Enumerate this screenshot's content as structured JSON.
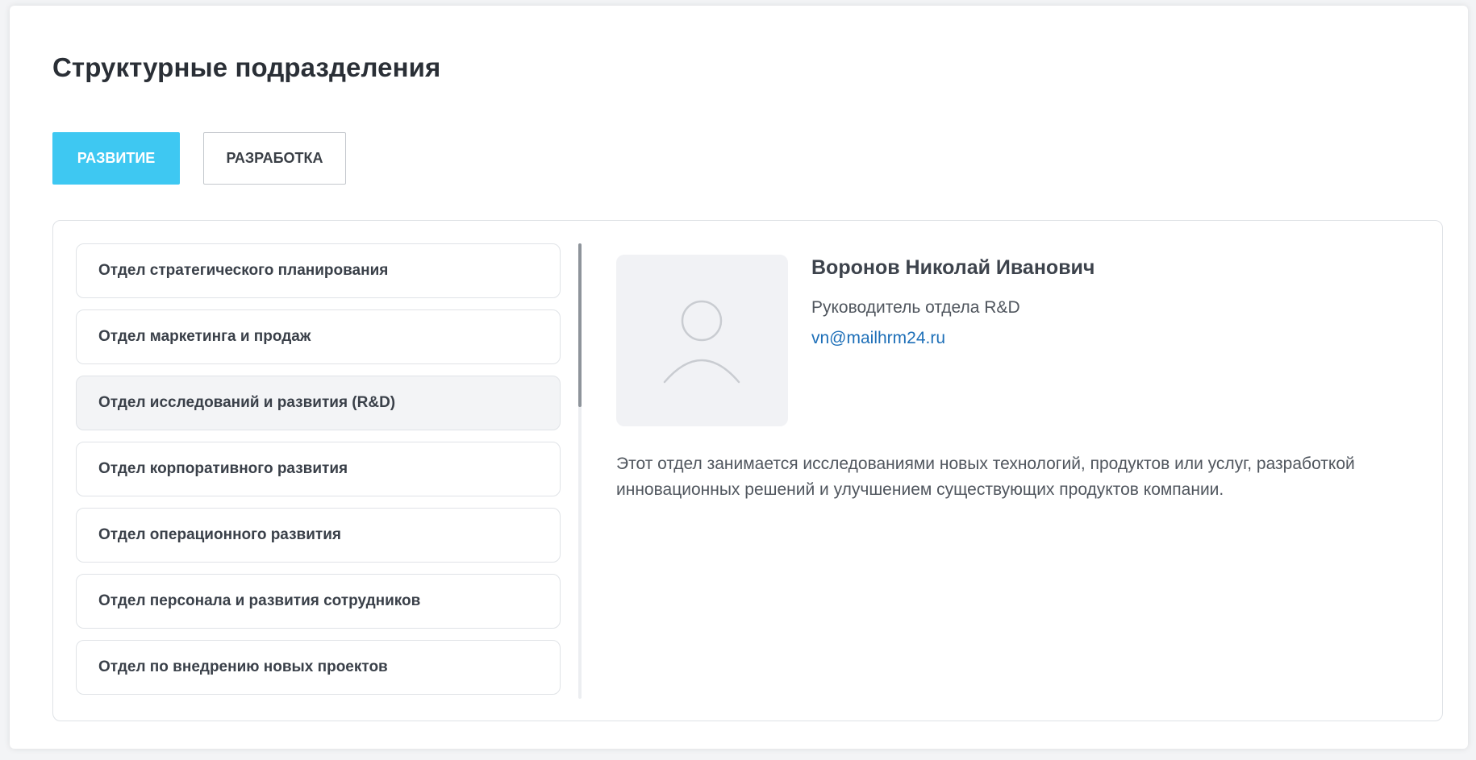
{
  "page": {
    "title": "Структурные подразделения"
  },
  "tabs": [
    {
      "label": "РАЗВИТИЕ",
      "active": true
    },
    {
      "label": "РАЗРАБОТКА",
      "active": false
    }
  ],
  "departments": [
    {
      "label": "Отдел стратегического планирования",
      "selected": false
    },
    {
      "label": "Отдел маркетинга и продаж",
      "selected": false
    },
    {
      "label": "Отдел исследований и развития (R&D)",
      "selected": true
    },
    {
      "label": "Отдел корпоративного развития",
      "selected": false
    },
    {
      "label": "Отдел операционного развития",
      "selected": false
    },
    {
      "label": "Отдел персонала и развития сотрудников",
      "selected": false
    },
    {
      "label": "Отдел по внедрению новых проектов",
      "selected": false
    }
  ],
  "details": {
    "avatar_icon": "user-placeholder-icon",
    "name": "Воронов Николай Иванович",
    "role": "Руководитель отдела R&D",
    "email": "vn@mailhrm24.ru",
    "description": "Этот отдел занимается исследованиями новых технологий, продуктов или услуг, разработкой инновационных решений и улучшением существующих продуктов компании."
  },
  "colors": {
    "accent": "#3ec8f2",
    "link": "#1d6fb8",
    "selected_bg": "#f3f4f6"
  }
}
